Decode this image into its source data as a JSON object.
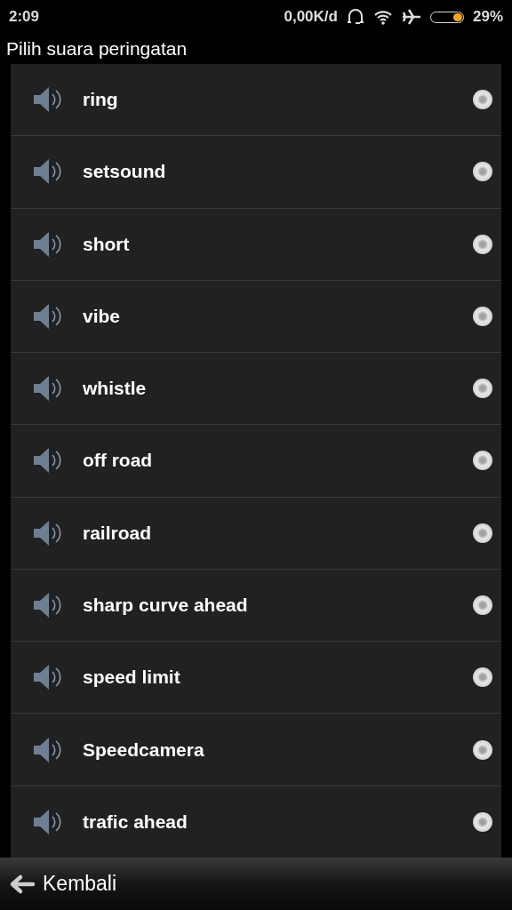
{
  "status_bar": {
    "time": "2:09",
    "speed": "0,00K/d",
    "battery": "29%"
  },
  "title": "Pilih suara peringatan",
  "sounds": [
    {
      "name": "ring",
      "selected": false
    },
    {
      "name": "setsound",
      "selected": false
    },
    {
      "name": "short",
      "selected": false
    },
    {
      "name": "vibe",
      "selected": false
    },
    {
      "name": "whistle",
      "selected": false
    },
    {
      "name": "off road",
      "selected": false
    },
    {
      "name": "railroad",
      "selected": false
    },
    {
      "name": "sharp curve ahead",
      "selected": false
    },
    {
      "name": "speed limit",
      "selected": false
    },
    {
      "name": "Speedcamera",
      "selected": false
    },
    {
      "name": "trafic ahead",
      "selected": false
    }
  ],
  "back_button": "Kembali"
}
